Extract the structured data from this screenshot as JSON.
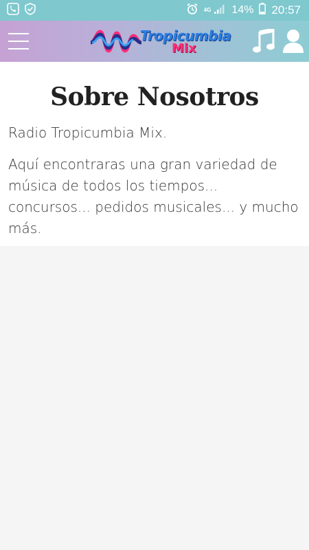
{
  "status_bar": {
    "network_label": "4G",
    "battery_percent": "14%",
    "time": "20:57",
    "icons": [
      "phone-icon",
      "shield-icon",
      "alarm-icon",
      "signal-icon",
      "battery-icon"
    ]
  },
  "app_bar": {
    "logo_title": "Tropicumbia",
    "logo_subtitle": "Mix",
    "menu_icon": "hamburger-icon",
    "music_icon": "music-note-icon",
    "user_icon": "user-icon"
  },
  "page": {
    "title": "Sobre Nosotros",
    "paragraph_1": "Radio Tropicumbia Mix.",
    "paragraph_2": "Aquí encontraras una gran variedad de música de todos los tiempos... concursos... pedidos musicales... y mucho más."
  },
  "colors": {
    "status_bar": "#7ec8ce",
    "app_bar_start": "#c5a2d4",
    "app_bar_end": "#8ccdd3",
    "logo_blue": "#2b7de0",
    "logo_pink": "#ff2f7a",
    "background": "#f5f5f5"
  }
}
